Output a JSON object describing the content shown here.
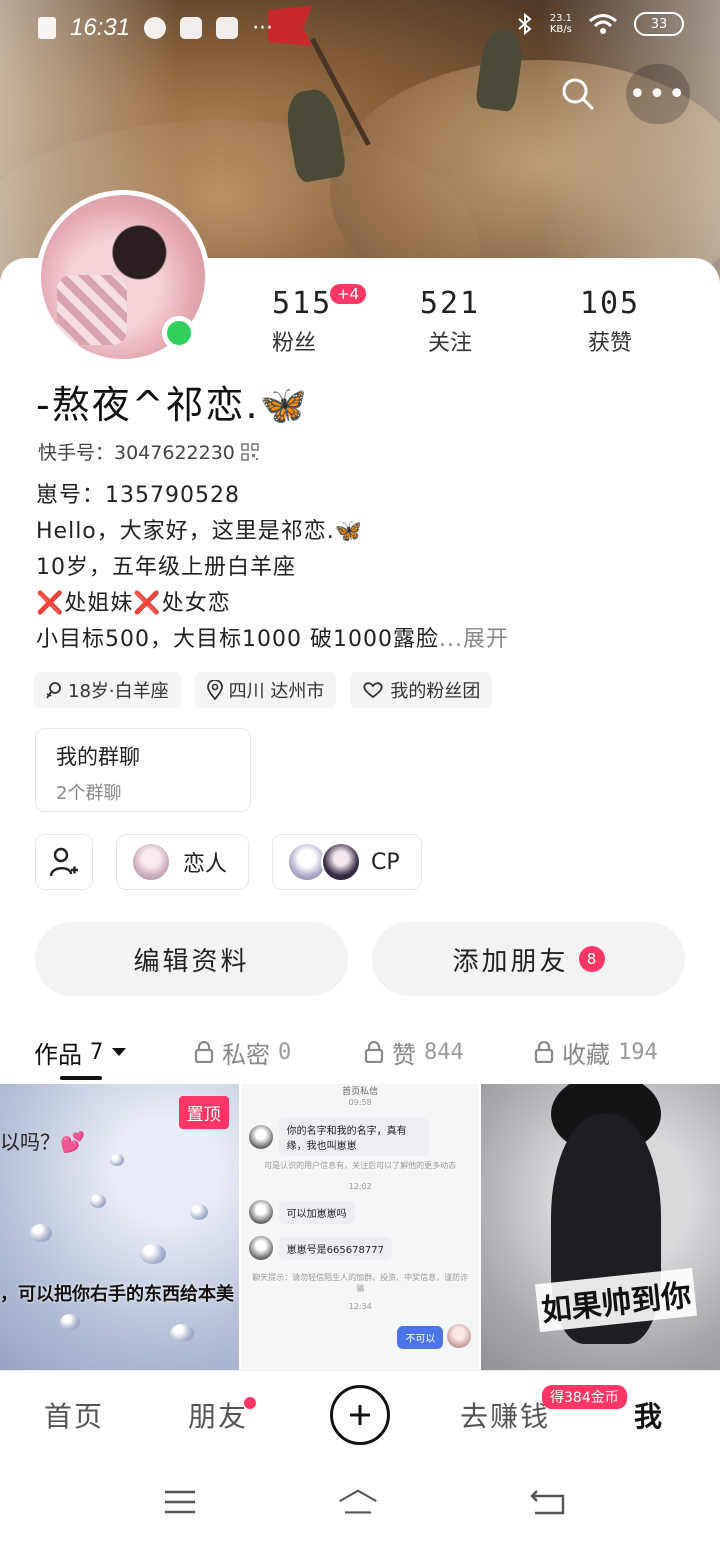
{
  "status_bar": {
    "time": "16:31",
    "net_speed": "23.1",
    "net_unit": "KB/s",
    "battery": "33"
  },
  "profile": {
    "stats": [
      {
        "value": "515",
        "label": "粉丝",
        "badge": "+4"
      },
      {
        "value": "521",
        "label": "关注"
      },
      {
        "value": "105",
        "label": "获赞"
      }
    ],
    "nickname": "-熬夜^祁恋.🦋",
    "kuaishou_id": "快手号：3047622230",
    "bio_lines": [
      "崽号：135790528",
      "Hello，大家好，这里是祁恋.🦋",
      "10岁，五年级上册白羊座",
      "❌处姐妹❌处女恋",
      "小目标500，大目标1000 破1000露脸"
    ],
    "bio_more": "...展开",
    "tags": [
      {
        "icon": "gender-icon",
        "text": "18岁·白羊座"
      },
      {
        "icon": "location-icon",
        "text": "四川 达州市"
      },
      {
        "icon": "fan-club-icon",
        "text": "我的粉丝团"
      }
    ],
    "group_chat": {
      "title": "我的群聊",
      "subtitle": "2个群聊"
    },
    "relations": [
      {
        "label": "恋人"
      },
      {
        "label": "CP"
      }
    ],
    "buttons": {
      "edit_profile": "编辑资料",
      "add_friend": "添加朋友",
      "add_friend_badge": "8"
    }
  },
  "tabs": [
    {
      "label": "作品",
      "count": "7"
    },
    {
      "label": "私密",
      "count": "0"
    },
    {
      "label": "赞",
      "count": "844"
    },
    {
      "label": "收藏",
      "count": "194"
    }
  ],
  "works": [
    {
      "pinned_label": "置顶",
      "question": "以吗？💕",
      "caption": "，可以把你右手的东西给本美"
    },
    {
      "header": "首页私信",
      "time1": "09:58",
      "msg1": "你的名字和我的名字，真有缘，我也叫崽崽",
      "sys1": "可是认识的用户信息有，关注后可以了解他的更多动态",
      "time2": "12:02",
      "msg2": "可以加崽崽吗",
      "msg3": "崽崽号是665678777",
      "sys2": "聊天提示：请勿轻信陌生人的加群、投资、中奖信息，谨防诈骗",
      "time3": "12:34",
      "mine": "不可以"
    },
    {
      "caption": "如果帅到你"
    }
  ],
  "bottom_nav": {
    "home": "首页",
    "friends": "朋友",
    "earn": "去赚钱",
    "earn_badge": "得384金币",
    "me": "我"
  }
}
